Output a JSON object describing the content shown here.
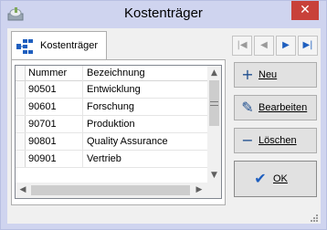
{
  "window": {
    "title": "Kostenträger",
    "close_symbol": "✕",
    "app_icon": "cloud-app-icon"
  },
  "tab": {
    "label": "Kostenträger",
    "icon": "hierarchy-icon"
  },
  "nav": {
    "first": "|◀",
    "prev": "◀",
    "next": "▶",
    "last": "▶|"
  },
  "grid": {
    "columns": [
      "Nummer",
      "Bezeichnung"
    ],
    "rows": [
      {
        "nummer": "90501",
        "bezeichnung": "Entwicklung"
      },
      {
        "nummer": "90601",
        "bezeichnung": "Forschung"
      },
      {
        "nummer": "90701",
        "bezeichnung": "Produktion"
      },
      {
        "nummer": "90801",
        "bezeichnung": "Quality Assurance"
      },
      {
        "nummer": "90901",
        "bezeichnung": "Vertrieb"
      }
    ]
  },
  "buttons": {
    "neu": {
      "label": "Neu",
      "icon": "plus-icon"
    },
    "bearbeiten": {
      "label": "Bearbeiten",
      "icon": "pencil-icon"
    },
    "loeschen": {
      "label": "Löschen",
      "icon": "minus-icon"
    },
    "ok": {
      "label": "OK",
      "icon": "checkmark-icon"
    }
  },
  "colors": {
    "titlebar": "#cfd4ef",
    "close": "#c8413a",
    "accent": "#1f5fbf"
  }
}
